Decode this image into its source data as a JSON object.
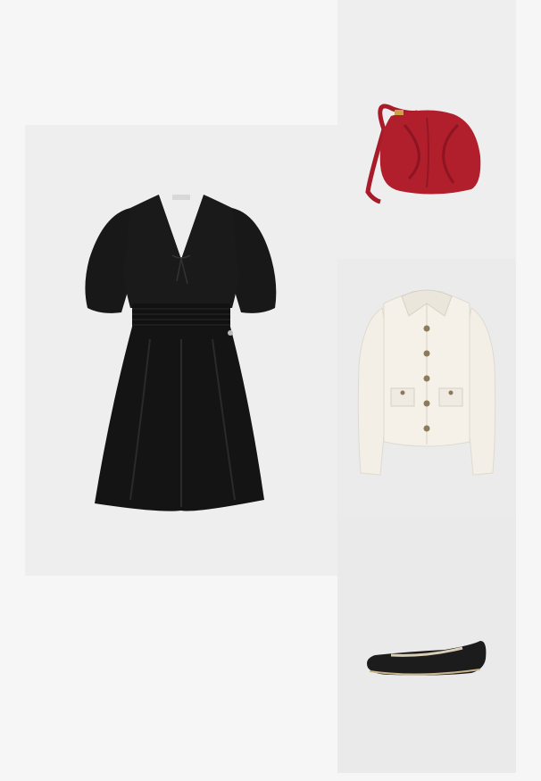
{
  "outfit": {
    "items": [
      {
        "name": "dress",
        "color": "#151515"
      },
      {
        "name": "bag",
        "color": "#b11f2c"
      },
      {
        "name": "cardigan",
        "color": "#f3efe6"
      },
      {
        "name": "flats",
        "color": "#1c1c1c"
      }
    ]
  },
  "colors": {
    "page_background": "#f6f6f6",
    "tile_background": "#eeeeee"
  }
}
